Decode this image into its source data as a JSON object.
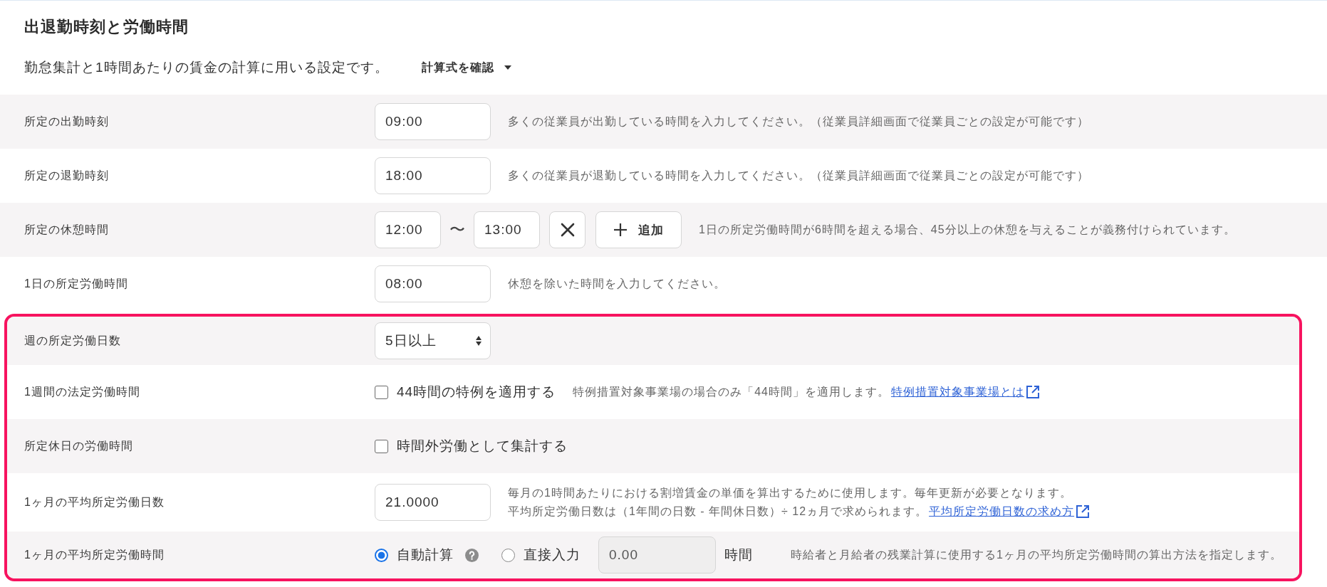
{
  "header": {
    "title": "出退勤時刻と労働時間",
    "description": "勤怠集計と1時間あたりの賃金の計算に用いる設定です。",
    "formula_toggle": {
      "label": "計算式を確認",
      "expanded": false
    }
  },
  "sections": [
    {
      "highlighted": false,
      "rows": [
        {
          "kind": "input",
          "label": "所定の出勤時刻",
          "value": "09:00",
          "hint_lines": [
            "多くの従業員が出勤している時間を入力してください。（従業員詳細画面で従業員ごとの設定が可能です）"
          ]
        },
        {
          "kind": "input",
          "label": "所定の退勤時刻",
          "value": "18:00",
          "hint_lines": [
            "多くの従業員が退勤している時間を入力してください。（従業員詳細画面で従業員ごとの設定が可能です）"
          ]
        },
        {
          "kind": "break",
          "label": "所定の休憩時間",
          "ranges": [
            {
              "start": "12:00",
              "separator": "〜",
              "end": "13:00"
            }
          ],
          "add_button": "追加",
          "hint_lines": [
            "1日の所定労働時間が6時間を超える場合、45分以上の休憩を与えることが義務付けられています。"
          ]
        },
        {
          "kind": "input",
          "label": "1日の所定労働時間",
          "value": "08:00",
          "hint_lines": [
            "休憩を除いた時間を入力してください。"
          ]
        }
      ]
    },
    {
      "highlighted": true,
      "rows": [
        {
          "kind": "select",
          "label": "週の所定労働日数",
          "value": "5日以上"
        },
        {
          "kind": "checkbox",
          "label": "1週間の法定労働時間",
          "checkbox": {
            "label": "44時間の特例を適用する",
            "checked": false
          },
          "hint_lines": [
            "特例措置対象事業場の場合のみ「44時間」を適用します。"
          ],
          "link": "特例措置対象事業場とは"
        },
        {
          "kind": "checkbox",
          "label": "所定休日の労働時間",
          "checkbox": {
            "label": "時間外労働として集計する",
            "checked": false
          }
        },
        {
          "kind": "input",
          "label": "1ヶ月の平均所定労働日数",
          "value": "21.0000",
          "hint_lines": [
            "毎月の1時間あたりにおける割増賃金の単価を算出するために使用します。毎年更新が必要となります。",
            "平均所定労働日数は（1年間の日数 - 年間休日数）÷ 12ヵ月で求められます。"
          ],
          "link": "平均所定労働日数の求め方"
        },
        {
          "kind": "radio",
          "label": "1ヶ月の平均所定労働時間",
          "options": [
            {
              "label": "自動計算",
              "selected": true,
              "help": true
            },
            {
              "label": "直接入力",
              "selected": false,
              "help": false
            }
          ],
          "input": {
            "value": "0.00",
            "disabled": true
          },
          "unit": "時間",
          "hint_lines": [
            "時給者と月給者の残業計算に使用する1ヶ月の平均所定労働時間の算出方法を指定します。"
          ]
        }
      ]
    }
  ]
}
